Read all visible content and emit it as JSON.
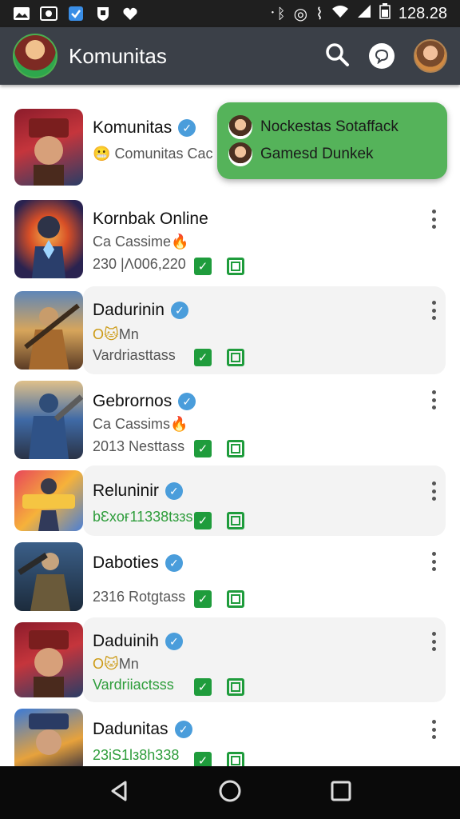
{
  "status_bar": {
    "time": "128.28",
    "icons": [
      "image-icon",
      "photo-icon",
      "checkbox-icon",
      "shield-icon",
      "heart-icon"
    ],
    "right_icons": [
      "bluetooth-icon",
      "alarm-icon",
      "vibrate-icon",
      "wifi-icon",
      "signal-icon",
      "battery-icon"
    ]
  },
  "app_bar": {
    "title": "Komunitas",
    "actions": [
      "search-icon",
      "chat-icon",
      "profile-avatar"
    ]
  },
  "popup": {
    "items": [
      {
        "label": "Nockestas Sotaffack"
      },
      {
        "label": "Gamesd Dunkek"
      }
    ],
    "color": "#55b35a"
  },
  "list": {
    "items": [
      {
        "name": "Komunitas",
        "verified": true,
        "line1": "Comunitas Cac",
        "line1_emoji": "😬",
        "line2": "",
        "badges": false
      },
      {
        "name": "Kornbak Online",
        "verified": false,
        "line1": "Ca Cassime",
        "line1_emoji": "🔥",
        "line2": "230 |Λ006,220",
        "badges": true
      },
      {
        "name": "Dadurinin",
        "verified": true,
        "line1": "Mn",
        "line1_prefix": "O",
        "line1_emoji": "🐱",
        "line2": "Vardriasttass",
        "badges": true
      },
      {
        "name": "Gebrornos",
        "verified": true,
        "line1": "Ca Cassims",
        "line1_emoji": "🔥",
        "line2": "2013 Nesttass",
        "badges": true
      },
      {
        "name": "Reluninir",
        "verified": true,
        "line1": "bƐxoғ11338tззs",
        "line2": "",
        "badges": true
      },
      {
        "name": "Daboties",
        "verified": true,
        "line1": "",
        "line2": "2316 Rotgtass",
        "badges": true
      },
      {
        "name": "Daduinih",
        "verified": true,
        "line1": "Mn",
        "line1_prefix": "O",
        "line1_emoji": "🐱",
        "line2": "Vardriiactsss",
        "badges": true
      },
      {
        "name": "Dadunitas",
        "verified": true,
        "line1": "23iS1Ɩз8h338",
        "line2": "",
        "badges": true
      }
    ]
  },
  "colors": {
    "appbar": "#3b4048",
    "accent_green": "#1f9c3c",
    "verified_blue": "#4a9ddb"
  },
  "nav_bar": {
    "buttons": [
      "back-icon",
      "home-icon",
      "recents-icon"
    ]
  }
}
